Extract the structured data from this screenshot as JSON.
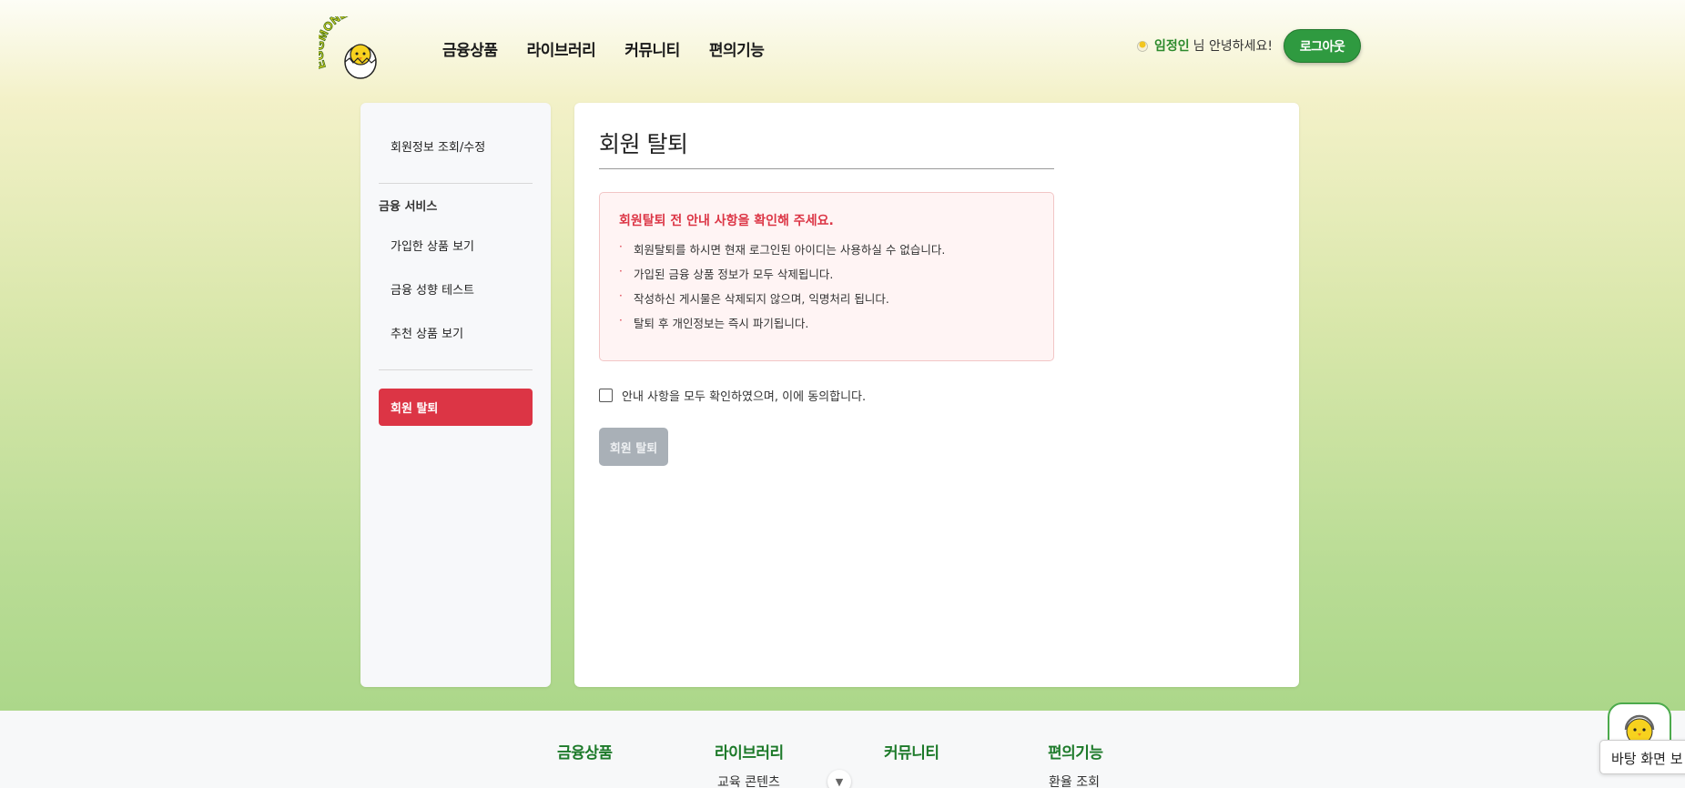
{
  "header": {
    "logo_text": "EGGMONEYNA",
    "nav": [
      "금융상품",
      "라이브러리",
      "커뮤니티",
      "편의기능"
    ],
    "user_name": "임정인",
    "greeting_suffix": "님 안녕하세요!",
    "logout_label": "로그아웃"
  },
  "sidebar": {
    "profile_link": "회원정보 조회/수정",
    "section_title": "금융 서비스",
    "items": [
      "가입한 상품 보기",
      "금융 성향 테스트",
      "추천 상품 보기"
    ],
    "active_item": "회원 탈퇴"
  },
  "main": {
    "title": "회원 탈퇴",
    "notice_title": "회원탈퇴 전 안내 사항을 확인해 주세요.",
    "notice_items": [
      "회원탈퇴를 하시면 현재 로그인된 아이디는 사용하실 수 없습니다.",
      "가입된 금융 상품 정보가 모두 삭제됩니다.",
      "작성하신 게시물은 삭제되지 않으며, 익명처리 됩니다.",
      "탈퇴 후 개인정보는 즉시 파기됩니다."
    ],
    "agree_label": "안내 사항을 모두 확인하였으며, 이에 동의합니다.",
    "agree_checked": false,
    "withdraw_button": "회원 탈퇴"
  },
  "footer": {
    "columns": [
      {
        "title": "금융상품",
        "first_link": ""
      },
      {
        "title": "라이브러리",
        "first_link": "교육 콘텐츠"
      },
      {
        "title": "커뮤니티",
        "first_link": ""
      },
      {
        "title": "편의기능",
        "first_link": "환율 조회"
      }
    ]
  },
  "chatbot": {
    "tooltip": "바탕 화면 보"
  },
  "colors": {
    "accent_green": "#2f9a40",
    "danger_red": "#dc3545",
    "disabled_gray": "#a9b0b7"
  }
}
